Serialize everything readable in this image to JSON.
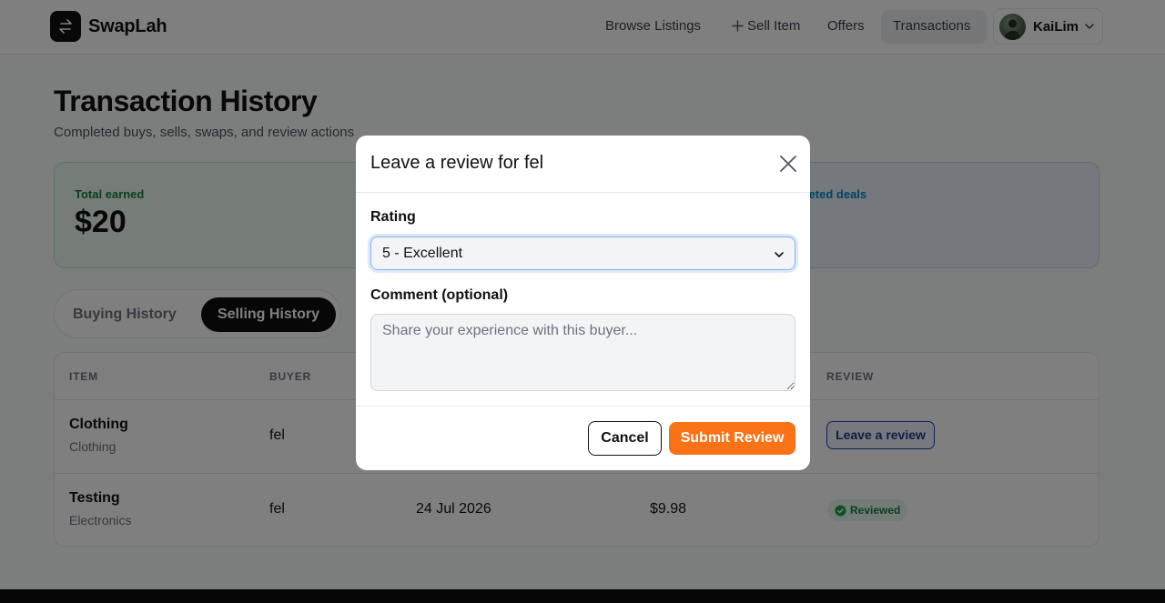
{
  "header": {
    "brand": "SwapLah",
    "nav": {
      "browse": "Browse Listings",
      "sell": "Sell Item",
      "offers": "Offers",
      "transactions": "Transactions"
    },
    "user": {
      "name": "KaiLim"
    }
  },
  "page": {
    "title": "Transaction History",
    "subtitle": "Completed buys, sells, swaps, and review actions"
  },
  "summary": {
    "earned_label": "Total earned",
    "earned_value": "$20",
    "deals_label": "pleted deals"
  },
  "tabs": {
    "buying": "Buying History",
    "selling": "Selling History",
    "active": "selling"
  },
  "table": {
    "headers": {
      "item": "ITEM",
      "buyer": "BUYER",
      "review": "REVIEW"
    },
    "rows": [
      {
        "item": "Clothing",
        "category": "Clothing",
        "buyer": "fel",
        "review_action": "Leave a review"
      },
      {
        "item": "Testing",
        "category": "Electronics",
        "buyer": "fel",
        "date": "24 Jul 2026",
        "amount": "$9.98",
        "review_status": "Reviewed"
      }
    ]
  },
  "modal": {
    "title": "Leave a review for fel",
    "rating_label": "Rating",
    "rating_value": "5 - Excellent",
    "comment_label": "Comment (optional)",
    "comment_placeholder": "Share your experience with this buyer...",
    "cancel_label": "Cancel",
    "submit_label": "Submit Review"
  },
  "colors": {
    "accent": "#f97316",
    "dark": "#0f0f0f",
    "earned_green": "#15803d",
    "deals_blue": "#0284c7",
    "link_blue": "#1e40af"
  },
  "icons": {
    "logo": "swap-arrows-icon",
    "sell": "plus-icon",
    "user_menu": "chevron-down-icon",
    "close": "close-icon",
    "select": "chevron-down-icon",
    "reviewed": "check-circle-icon"
  }
}
